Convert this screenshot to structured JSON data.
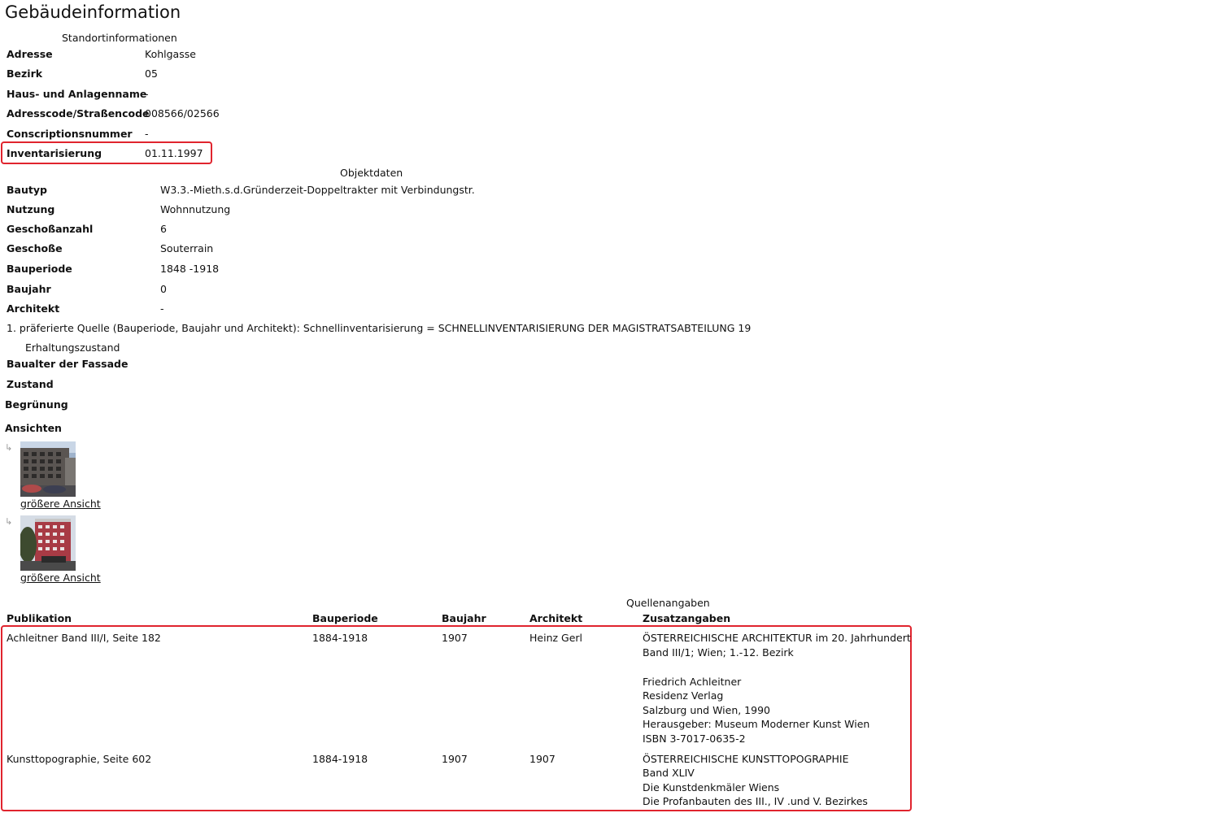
{
  "page_title": "Gebäudeinformation",
  "standort": {
    "caption": "Standortinformationen",
    "rows": [
      {
        "label": "Adresse",
        "value": "Kohlgasse"
      },
      {
        "label": "Bezirk",
        "value": "05"
      },
      {
        "label": "Haus- und Anlagenname",
        "value": "-"
      },
      {
        "label": "Adresscode/Straßencode",
        "value": "008566/02566"
      },
      {
        "label": "Conscriptionsnummer",
        "value": "-"
      },
      {
        "label": "Inventarisierung",
        "value": "01.11.1997"
      }
    ]
  },
  "objekt": {
    "caption": "Objektdaten",
    "rows": [
      {
        "label": "Bautyp",
        "value": "W3.3.-Mieth.s.d.Gründerzeit-Doppeltrakter mit Verbindungstr."
      },
      {
        "label": "Nutzung",
        "value": "Wohnnutzung"
      },
      {
        "label": "Geschoßanzahl",
        "value": "6"
      },
      {
        "label": "Geschoße",
        "value": "Souterrain"
      },
      {
        "label": "Bauperiode",
        "value": "1848 -1918"
      },
      {
        "label": "Baujahr",
        "value": "0"
      },
      {
        "label": "Architekt",
        "value": "-"
      }
    ],
    "quelle_note": "1. präferierte Quelle (Bauperiode, Baujahr und Architekt): Schnellinventarisierung = SCHNELLINVENTARISIERUNG DER MAGISTRATSABTEILUNG 19"
  },
  "erhaltung": {
    "caption": "Erhaltungszustand",
    "rows": [
      {
        "label": "Baualter der Fassade",
        "value": "-"
      },
      {
        "label": "Zustand",
        "value": ""
      },
      {
        "label": "Begrünung",
        "value": ""
      }
    ]
  },
  "ansichten": {
    "heading": "Ansichten",
    "arrow": "↳",
    "items": [
      {
        "link": "größere Ansicht"
      },
      {
        "link": "größere Ansicht"
      }
    ]
  },
  "quellen": {
    "caption": "Quellenangaben",
    "headers": [
      "Publikation",
      "Bauperiode",
      "Baujahr",
      "Architekt",
      "Zusatzangaben"
    ],
    "rows": [
      {
        "publikation": "Achleitner Band III/I, Seite 182",
        "bauperiode": "1884-1918",
        "baujahr": "1907",
        "architekt": "Heinz Gerl",
        "zusatz": [
          "ÖSTERREICHISCHE ARCHITEKTUR im 20. Jahrhundert",
          "Band III/1; Wien; 1.-12. Bezirk",
          "",
          "Friedrich Achleitner",
          "Residenz Verlag",
          "Salzburg und Wien, 1990",
          "Herausgeber: Museum Moderner Kunst Wien",
          "ISBN 3-7017-0635-2"
        ]
      },
      {
        "publikation": "Kunsttopographie, Seite 602",
        "bauperiode": "1884-1918",
        "baujahr": "1907",
        "architekt": "1907",
        "zusatz": [
          "ÖSTERREICHISCHE KUNSTTOPOGRAPHIE",
          "Band XLIV",
          "Die Kunstdenkmäler Wiens",
          "Die Profanbauten des III., IV .und V. Bezirkes"
        ]
      }
    ]
  },
  "colors": {
    "highlight": "#e0242e"
  }
}
